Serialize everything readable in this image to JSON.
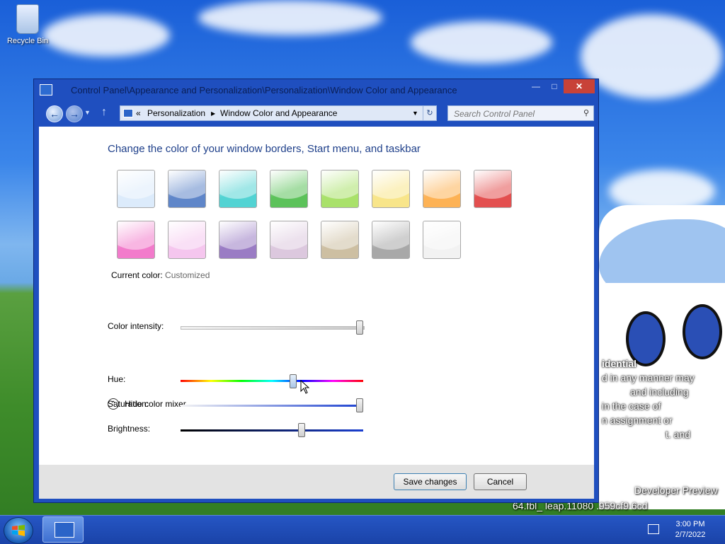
{
  "desktop": {
    "recycle_bin_label": "Recycle Bin",
    "overlay_lines": [
      "idential",
      "d in any manner may",
      "and including",
      "in the case of",
      "n assignment or",
      "t. and"
    ],
    "watermark_line1": "Developer Preview",
    "watermark_line2": "64.fbl_ leap.11080 .959cf9 6cd"
  },
  "window": {
    "title": "Control Panel\\Appearance and Personalization\\Personalization\\Window Color and Appearance",
    "controls": {
      "minimize": "—",
      "maximize": "□",
      "close": "✕"
    },
    "address": {
      "prefix": "«",
      "crumbs": [
        "Personalization",
        "Window Color and Appearance"
      ]
    },
    "search_placeholder": "Search Control Panel"
  },
  "content": {
    "heading": "Change the color of your window borders, Start menu, and taskbar",
    "swatches": [
      {
        "name": "sky",
        "color": "#dcebfb"
      },
      {
        "name": "twilight",
        "color": "#5f86c9"
      },
      {
        "name": "sea",
        "color": "#52d3d3"
      },
      {
        "name": "leaf",
        "color": "#5cc25a"
      },
      {
        "name": "lime",
        "color": "#a9e16a"
      },
      {
        "name": "pumpkin-light",
        "color": "#f8e58a"
      },
      {
        "name": "pumpkin",
        "color": "#fdb255"
      },
      {
        "name": "ruby",
        "color": "#e34f4f"
      },
      {
        "name": "fuchsia",
        "color": "#f27bcb"
      },
      {
        "name": "blush",
        "color": "#f5c6ee"
      },
      {
        "name": "violet",
        "color": "#9a7cc4"
      },
      {
        "name": "lavender",
        "color": "#dcc8de"
      },
      {
        "name": "taupe",
        "color": "#cdbfa2"
      },
      {
        "name": "chocolate",
        "color": "#a8a8a8"
      },
      {
        "name": "frost",
        "color": "#f2f2f2"
      }
    ],
    "current_color_label": "Current color:",
    "current_color_value": "Customized",
    "intensity_label": "Color intensity:",
    "intensity_level": 1.0,
    "mixer_toggle_label": "Hide color mixer",
    "hue_label": "Hue:",
    "hue_level": 0.62,
    "saturation_label": "Saturation:",
    "saturation_level": 1.0,
    "brightness_label": "Brightness:",
    "brightness_level": 0.67
  },
  "footer": {
    "save_label": "Save changes",
    "cancel_label": "Cancel"
  },
  "taskbar": {
    "time": "3:00 PM",
    "date": "2/7/2022"
  }
}
